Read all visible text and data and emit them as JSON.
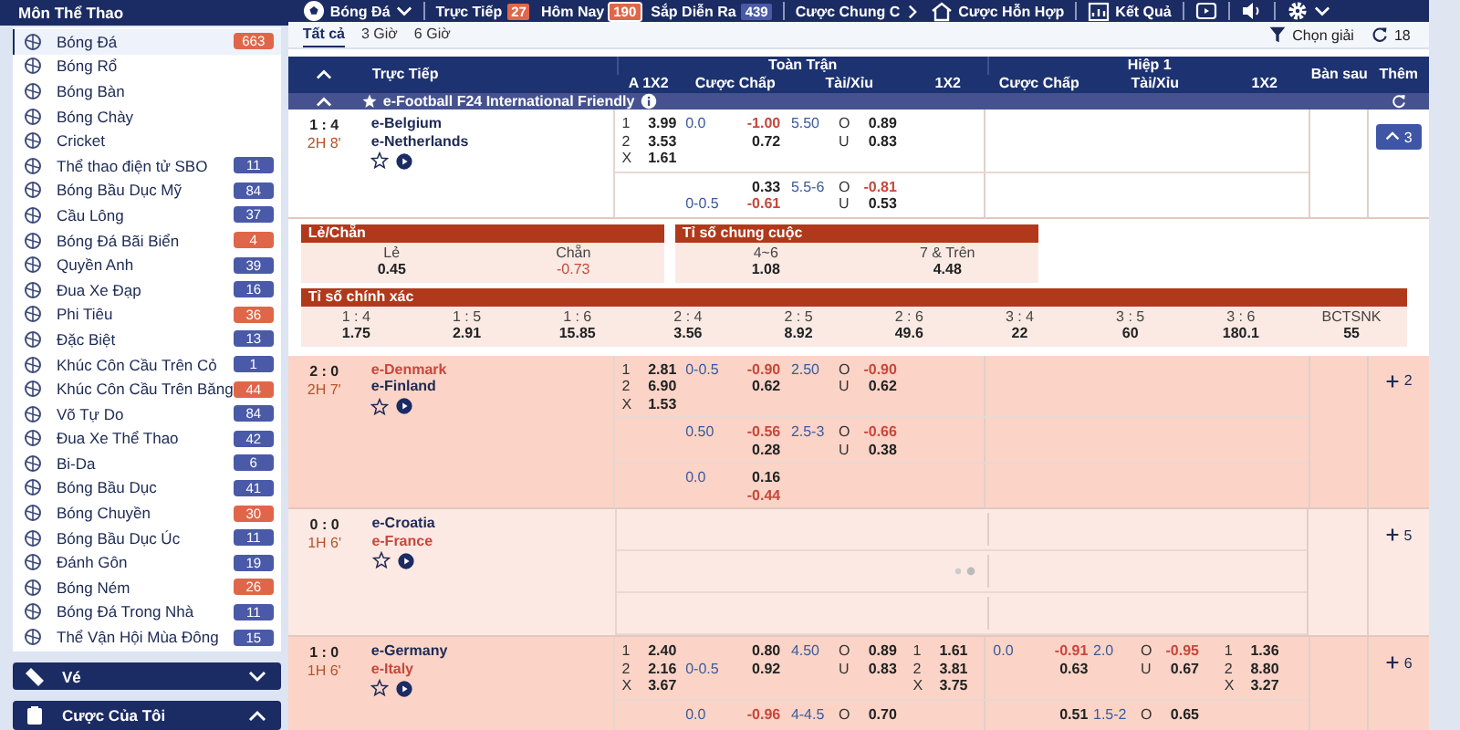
{
  "sidebar": {
    "title": "Môn Thể Thao",
    "items": [
      {
        "label": "Bóng Đá",
        "count": "663",
        "color": "#e0664a",
        "selected": true
      },
      {
        "label": "Bóng Rổ",
        "selected": false
      },
      {
        "label": "Bóng Bàn",
        "selected": false
      },
      {
        "label": "Bóng Chày",
        "selected": false
      },
      {
        "label": "Cricket",
        "selected": false
      },
      {
        "label": "Thể thao điện tử SBO",
        "count": "11",
        "color": "#4a5aa8",
        "selected": false
      },
      {
        "label": "Bóng Bầu Dục Mỹ",
        "count": "84",
        "color": "#4a5aa8",
        "selected": false
      },
      {
        "label": "Cầu Lông",
        "count": "37",
        "color": "#4a5aa8",
        "selected": false
      },
      {
        "label": "Bóng Đá Bãi Biển",
        "count": "4",
        "color": "#e0664a",
        "selected": false
      },
      {
        "label": "Quyền Anh",
        "count": "39",
        "color": "#4a5aa8",
        "selected": false
      },
      {
        "label": "Đua Xe Đạp",
        "count": "16",
        "color": "#4a5aa8",
        "selected": false
      },
      {
        "label": "Phi Tiêu",
        "count": "36",
        "color": "#e0664a",
        "selected": false
      },
      {
        "label": "Đặc Biệt",
        "count": "13",
        "color": "#4a5aa8",
        "selected": false
      },
      {
        "label": "Khúc Côn Cầu Trên Cỏ",
        "count": "1",
        "color": "#4a5aa8",
        "selected": false
      },
      {
        "label": "Khúc Côn Cầu Trên Băng",
        "count": "44",
        "color": "#e0664a",
        "selected": false
      },
      {
        "label": "Võ Tự Do",
        "count": "84",
        "color": "#4a5aa8",
        "selected": false
      },
      {
        "label": "Đua Xe Thể Thao",
        "count": "42",
        "color": "#4a5aa8",
        "selected": false
      },
      {
        "label": "Bi-Da",
        "count": "6",
        "color": "#4a5aa8",
        "selected": false
      },
      {
        "label": "Bóng Bầu Dục",
        "count": "41",
        "color": "#4a5aa8",
        "selected": false
      },
      {
        "label": "Bóng Chuyền",
        "count": "30",
        "color": "#e0664a",
        "selected": false
      },
      {
        "label": "Bóng Bầu Dục Úc",
        "count": "11",
        "color": "#4a5aa8",
        "selected": false
      },
      {
        "label": "Đánh Gôn",
        "count": "19",
        "color": "#4a5aa8",
        "selected": false
      },
      {
        "label": "Bóng Ném",
        "count": "26",
        "color": "#e0664a",
        "selected": false
      },
      {
        "label": "Bóng Đá Trong Nhà",
        "count": "11",
        "color": "#4a5aa8",
        "selected": false
      },
      {
        "label": "Thể Vận Hội Mùa Đông",
        "count": "15",
        "color": "#4a5aa8",
        "selected": false
      }
    ],
    "sections": [
      {
        "label": "Vé",
        "expanded": false
      },
      {
        "label": "Cược Của Tôi",
        "expanded": true
      }
    ]
  },
  "nav": {
    "sport": "Bóng Đá",
    "tabs": [
      {
        "label": "Trực Tiếp",
        "count": "27",
        "color": "#e0664a",
        "selected": false
      },
      {
        "label": "Hôm Nay",
        "count": "190",
        "color": "#e0664a",
        "selected": true
      },
      {
        "label": "Sắp Diễn Ra",
        "count": "439",
        "color": "#4a5aa8",
        "selected": false
      }
    ],
    "more": "Cược Chung C",
    "parlay": "Cược Hỗn Hợp",
    "results": "Kết Quả"
  },
  "filters": {
    "tabs": [
      {
        "label": "Tất cả",
        "selected": true
      },
      {
        "label": "3 Giờ",
        "selected": false
      },
      {
        "label": "6 Giờ",
        "selected": false
      }
    ],
    "league_filter": "Chọn giải",
    "refresh": "18"
  },
  "table": {
    "live": "Trực Tiếp",
    "full_time": "Toàn Trận",
    "first_half": "Hiệp 1",
    "next_goal": "Bàn sau",
    "more": "Thêm",
    "columns": [
      "A 1X2",
      "Cược Chấp",
      "Tài/Xỉu",
      "1X2",
      "Cược Chấp",
      "Tài/Xỉu",
      "1X2"
    ],
    "league": "e-Football F24 International Friendly",
    "matches": [
      {
        "score": "1 : 4",
        "time": "2H 8'",
        "home": {
          "name": "e-Belgium",
          "favorite": false
        },
        "away": {
          "name": "e-Netherlands",
          "favorite": false
        },
        "color": "#ffffff",
        "more": "3",
        "expanded": true,
        "loading": false,
        "lines": [
          {
            "a_1x2": [
              {
                "side": "1",
                "odds": "3.99"
              },
              {
                "side": "2",
                "odds": "3.53"
              },
              {
                "side": "X",
                "odds": "1.61"
              }
            ],
            "hdp": [
              {
                "line": "0.0",
                "odds": "-1.00"
              },
              {
                "odds": "0.72"
              }
            ],
            "ou": [
              {
                "line": "5.50",
                "side": "O",
                "odds": "0.89"
              },
              {
                "side": "U",
                "odds": "0.83"
              }
            ]
          },
          {
            "hdp": [
              {
                "odds": "0.33"
              },
              {
                "line": "0-0.5",
                "odds": "-0.61"
              }
            ],
            "ou": [
              {
                "line": "5.5-6",
                "side": "O",
                "odds": "-0.81"
              },
              {
                "side": "U",
                "odds": "0.53"
              }
            ]
          }
        ],
        "panels": [
          {
            "title": "Lẻ/Chẵn",
            "items": [
              {
                "label": "Lẻ",
                "odds": "0.45"
              },
              {
                "label": "Chẵn",
                "odds": "-0.73"
              }
            ]
          },
          {
            "title": "Tỉ số chung cuộc",
            "items": [
              {
                "label": "4~6",
                "odds": "1.08"
              },
              {
                "label": "7 & Trên",
                "odds": "4.48"
              }
            ]
          }
        ],
        "correct_score": {
          "title": "Tỉ số chính xác",
          "items": [
            {
              "label": "1 : 4",
              "odds": "1.75"
            },
            {
              "label": "1 : 5",
              "odds": "2.91"
            },
            {
              "label": "1 : 6",
              "odds": "15.85"
            },
            {
              "label": "2 : 4",
              "odds": "3.56"
            },
            {
              "label": "2 : 5",
              "odds": "8.92"
            },
            {
              "label": "2 : 6",
              "odds": "49.6"
            },
            {
              "label": "3 : 4",
              "odds": "22"
            },
            {
              "label": "3 : 5",
              "odds": "60"
            },
            {
              "label": "3 : 6",
              "odds": "180.1"
            },
            {
              "label": "BCTSNK",
              "odds": "55"
            }
          ]
        }
      },
      {
        "score": "2 : 0",
        "time": "2H 7'",
        "home": {
          "name": "e-Denmark",
          "favorite": true
        },
        "away": {
          "name": "e-Finland",
          "favorite": false
        },
        "color": "#fbd4c7",
        "more": "2",
        "expanded": false,
        "loading": false,
        "lines": [
          {
            "a_1x2": [
              {
                "side": "1",
                "odds": "2.81"
              },
              {
                "side": "2",
                "odds": "6.90"
              },
              {
                "side": "X",
                "odds": "1.53"
              }
            ],
            "hdp": [
              {
                "line": "0-0.5",
                "odds": "-0.90"
              },
              {
                "odds": "0.62"
              }
            ],
            "ou": [
              {
                "line": "2.50",
                "side": "O",
                "odds": "-0.90"
              },
              {
                "side": "U",
                "odds": "0.62"
              }
            ]
          },
          {
            "hdp": [
              {
                "line": "0.50",
                "odds": "-0.56"
              },
              {
                "odds": "0.28"
              }
            ],
            "ou": [
              {
                "line": "2.5-3",
                "side": "O",
                "odds": "-0.66"
              },
              {
                "side": "U",
                "odds": "0.38"
              }
            ]
          },
          {
            "hdp": [
              {
                "line": "0.0",
                "odds": "0.16"
              },
              {
                "odds": "-0.44"
              }
            ]
          }
        ]
      },
      {
        "score": "0 : 0",
        "time": "1H 6'",
        "home": {
          "name": "e-Croatia",
          "favorite": false
        },
        "away": {
          "name": "e-France",
          "favorite": true
        },
        "color": "#fde9e3",
        "more": "5",
        "expanded": false,
        "loading": true
      },
      {
        "score": "1 : 0",
        "time": "1H 6'",
        "home": {
          "name": "e-Germany",
          "favorite": false
        },
        "away": {
          "name": "e-Italy",
          "favorite": true
        },
        "color": "#fbd4c7",
        "more": "6",
        "expanded": false,
        "loading": false,
        "lines": [
          {
            "a_1x2": [
              {
                "side": "1",
                "odds": "2.40"
              },
              {
                "side": "2",
                "odds": "2.16"
              },
              {
                "side": "X",
                "odds": "3.67"
              }
            ],
            "hdp": [
              {
                "odds": "0.80"
              },
              {
                "line": "0-0.5",
                "odds": "0.92"
              }
            ],
            "ou": [
              {
                "line": "4.50",
                "side": "O",
                "odds": "0.89"
              },
              {
                "side": "U",
                "odds": "0.83"
              }
            ],
            "x12": [
              {
                "side": "1",
                "odds": "1.61"
              },
              {
                "side": "2",
                "odds": "3.81"
              },
              {
                "side": "X",
                "odds": "3.75"
              }
            ],
            "h1_hdp": [
              {
                "line": "0.0",
                "odds": "-0.91"
              },
              {
                "odds": "0.63"
              }
            ],
            "h1_ou": [
              {
                "line": "2.0",
                "side": "O",
                "odds": "-0.95"
              },
              {
                "side": "U",
                "odds": "0.67"
              }
            ],
            "h1_x12": [
              {
                "side": "1",
                "odds": "1.36"
              },
              {
                "side": "2",
                "odds": "8.80"
              },
              {
                "side": "X",
                "odds": "3.27"
              }
            ]
          },
          {
            "hdp": [
              {
                "line": "0.0",
                "odds": "-0.96"
              }
            ],
            "ou": [
              {
                "line": "4-4.5",
                "side": "O",
                "odds": "0.70"
              }
            ],
            "h1_hdp": [
              {
                "odds": "0.51"
              }
            ],
            "h1_ou": [
              {
                "line": "1.5-2",
                "side": "O",
                "odds": "0.65"
              }
            ]
          }
        ]
      }
    ]
  }
}
